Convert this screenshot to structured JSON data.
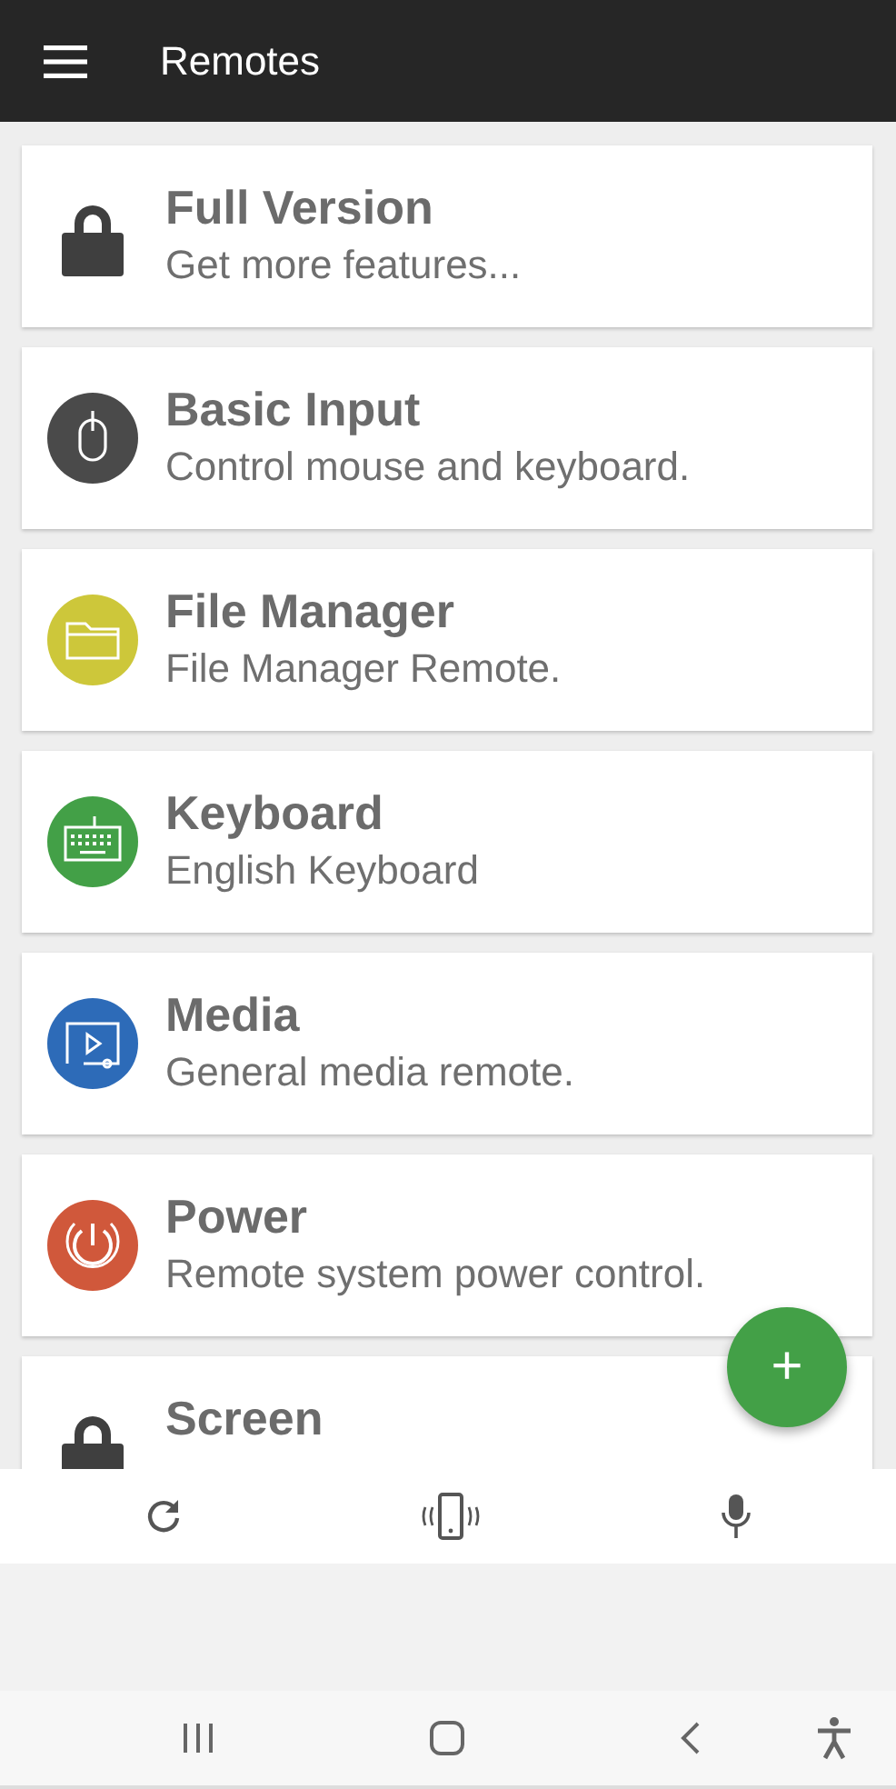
{
  "app_bar": {
    "title": "Remotes"
  },
  "remotes": [
    {
      "kind": "locked",
      "title": "Full Version",
      "subtitle": "Get more features..."
    },
    {
      "kind": "remote",
      "color": "#4a4a4a",
      "title": "Basic Input",
      "subtitle": "Control mouse and keyboard."
    },
    {
      "kind": "remote",
      "color": "#cdc73a",
      "title": "File Manager",
      "subtitle": "File Manager Remote."
    },
    {
      "kind": "remote",
      "color": "#43a047",
      "title": "Keyboard",
      "subtitle": "English Keyboard"
    },
    {
      "kind": "remote",
      "color": "#2d6bb8",
      "title": "Media",
      "subtitle": "General media remote."
    },
    {
      "kind": "remote",
      "color": "#d0583b",
      "title": "Power",
      "subtitle": "Remote system power control."
    },
    {
      "kind": "locked",
      "title": "Screen"
    }
  ],
  "fab": {
    "label": "+"
  }
}
